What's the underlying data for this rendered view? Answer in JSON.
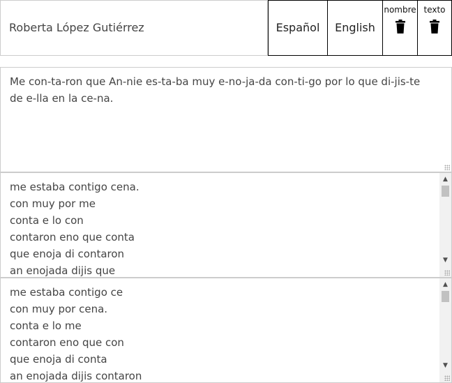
{
  "header": {
    "name": "Roberta López Gutiérrez",
    "buttons": {
      "spanish": "Español",
      "english": "English",
      "delete_name_label": "nombre",
      "delete_text_label": "texto"
    }
  },
  "syllabified_text": "Me con-ta-ron que An-nie es-ta-ba muy e-no-ja-da con-ti-go por lo que di-jis-te de e-lla en la ce-na.",
  "list1": {
    "lines": [
      "me estaba contigo cena.",
      "con muy por me",
      "conta e lo con",
      "contaron eno que conta",
      "que enoja di contaron",
      "an enojada dijis que"
    ]
  },
  "list2": {
    "lines": [
      "me estaba contigo ce",
      "con muy por cena.",
      "conta e lo me",
      "contaron eno que con",
      "que enoja di conta",
      "an enojada dijis contaron"
    ]
  },
  "icons": {
    "delete": "trash-icon",
    "scroll_up": "triangle-up-icon",
    "scroll_down": "triangle-down-icon",
    "resize": "resize-grip-icon"
  },
  "colors": {
    "border": "#cccccc",
    "button_border": "#000000",
    "text": "#444444",
    "scrollbar_track": "#f1f1f1",
    "scrollbar_thumb": "#c1c1c1"
  }
}
